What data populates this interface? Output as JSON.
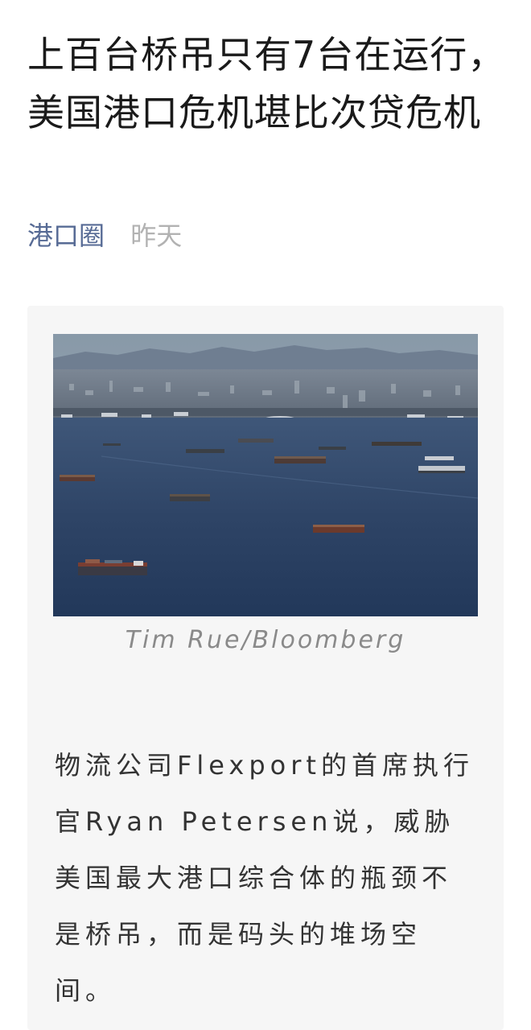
{
  "article": {
    "title": "上百台桥吊只有7台在运行，美国港口危机堪比次贷危机",
    "account": "港口圈",
    "time": "昨天"
  },
  "image": {
    "caption": "Tim Rue/Bloomberg"
  },
  "content": {
    "paragraph": "物流公司Flexport的首席执行官Ryan Petersen说，威胁美国最大港口综合体的瓶颈不是桥吊，而是码头的堆场空间。"
  }
}
